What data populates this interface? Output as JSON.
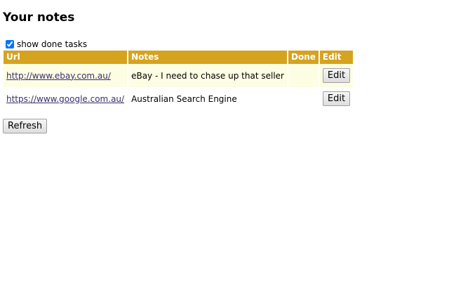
{
  "page": {
    "title": "Your notes"
  },
  "filter": {
    "show_done_label": "show done tasks",
    "show_done_checked": true
  },
  "table": {
    "headers": {
      "url": "Url",
      "notes": "Notes",
      "done": "Done",
      "edit": "Edit"
    },
    "rows": [
      {
        "url": "http://www.ebay.com.au/",
        "note": "eBay - I need to chase up that seller",
        "done": "",
        "edit_label": "Edit"
      },
      {
        "url": "https://www.google.com.au/",
        "note": "Australian Search Engine",
        "done": "",
        "edit_label": "Edit"
      }
    ]
  },
  "actions": {
    "refresh_label": "Refresh"
  },
  "colors": {
    "header_bg": "#d6a31f",
    "header_text": "#ffffff",
    "row_highlight": "#fdfde3",
    "link": "#3b2f6e"
  }
}
